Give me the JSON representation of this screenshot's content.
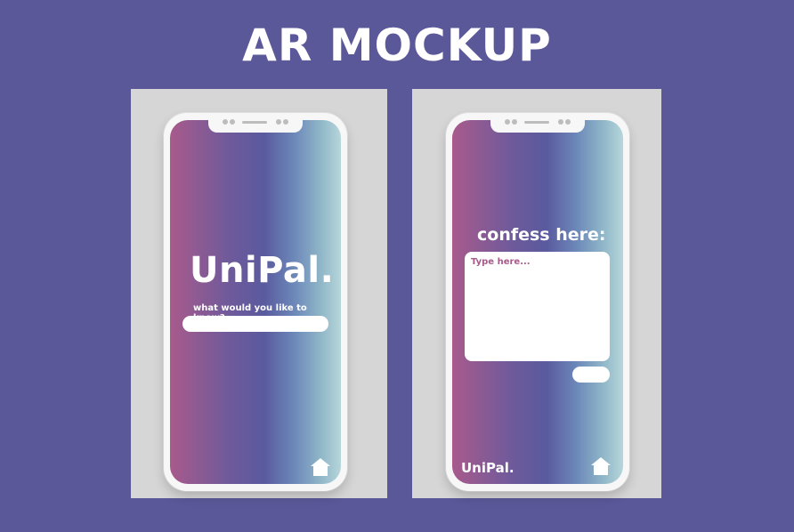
{
  "page": {
    "title": "AR MOCKUP"
  },
  "left_phone": {
    "brand": "UniPal",
    "brand_period": ".",
    "question": "what would you like to know?",
    "search_value": "",
    "home_icon": "home-icon"
  },
  "right_phone": {
    "confess_label": "confess here:",
    "confess_placeholder": "Type here...",
    "confess_value": "",
    "brand": "UniPal",
    "brand_period": ".",
    "home_icon": "home-icon"
  },
  "colors": {
    "background": "#5b5899",
    "gradient_start": "#a85a8c",
    "gradient_mid": "#5a5a9e",
    "gradient_end": "#b6d6da",
    "accent_text": "#a85a8c"
  }
}
